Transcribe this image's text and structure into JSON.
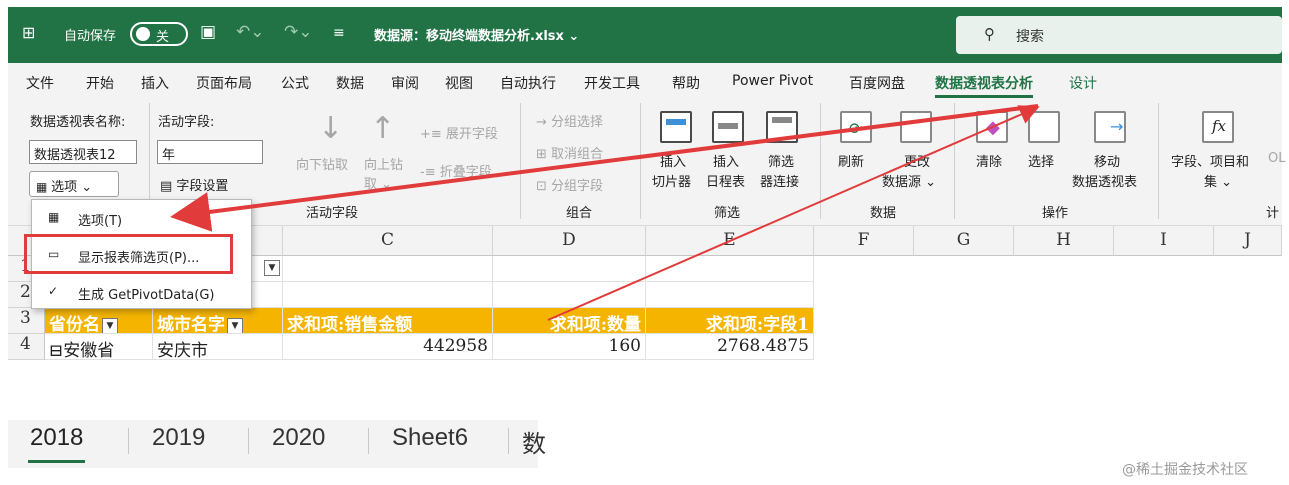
{
  "titlebar": {
    "autosave_label": "自动保存",
    "toggle_text": "关",
    "filename": "数据源：移动终端数据分析.xlsx ⌄",
    "search_placeholder": "搜索"
  },
  "menu": {
    "tabs": [
      "文件",
      "开始",
      "插入",
      "页面布局",
      "公式",
      "数据",
      "审阅",
      "视图",
      "自动执行",
      "开发工具",
      "帮助",
      "Power Pivot",
      "百度网盘",
      "数据透视表分析",
      "设计"
    ]
  },
  "ribbon": {
    "pivot_name_label": "数据透视表名称:",
    "pivot_name_value": "数据透视表12",
    "options_btn": "选项 ⌄",
    "active_field_label": "活动字段:",
    "active_field_value": "年",
    "field_settings": "字段设置",
    "drill_down": "向下钻取",
    "drill_up": "向上钻取 ⌄",
    "expand_field": "展开字段",
    "collapse_field": "折叠字段",
    "group_active_field": "活动字段",
    "group_selection": "分组选择",
    "ungroup": "取消组合",
    "group_field": "分组字段",
    "group_group": "组合",
    "insert_slicer_1": "插入",
    "insert_slicer_2": "切片器",
    "insert_timeline_1": "插入",
    "insert_timeline_2": "日程表",
    "filter_conn_1": "筛选",
    "filter_conn_2": "器连接",
    "group_filter": "筛选",
    "refresh": "刷新",
    "change_source_1": "更改",
    "change_source_2": "数据源 ⌄",
    "group_data": "数据",
    "clear": "清除",
    "select": "选择",
    "move_1": "移动",
    "move_2": "数据透视表",
    "group_actions": "操作",
    "fields_items_1": "字段、项目和",
    "fields_items_2": "集 ⌄",
    "olap": "OL",
    "group_calc": "计"
  },
  "popup": {
    "items": [
      {
        "label": "选项(T)"
      },
      {
        "label": "显示报表筛选页(P)..."
      },
      {
        "label": "生成 GetPivotData(G)"
      }
    ]
  },
  "grid": {
    "columns": [
      "C",
      "D",
      "E",
      "F",
      "G",
      "H",
      "I",
      "J"
    ],
    "rows": [
      "1",
      "2",
      "3",
      "4"
    ],
    "header_row": [
      "省份名",
      "城市名字",
      "求和项:销售金额",
      "求和项:数量",
      "求和项:字段1"
    ],
    "data_row": [
      "⊟安徽省",
      "安庆市",
      "442958",
      "160",
      "2768.4875"
    ]
  },
  "sheet_tabs": [
    "2018",
    "2019",
    "2020",
    "Sheet6",
    "数"
  ],
  "watermark": "@稀土掘金技术社区",
  "colors": {
    "excel_green": "#217346",
    "pivot_header": "#f4b400",
    "annotation_red": "#e23b3b"
  }
}
